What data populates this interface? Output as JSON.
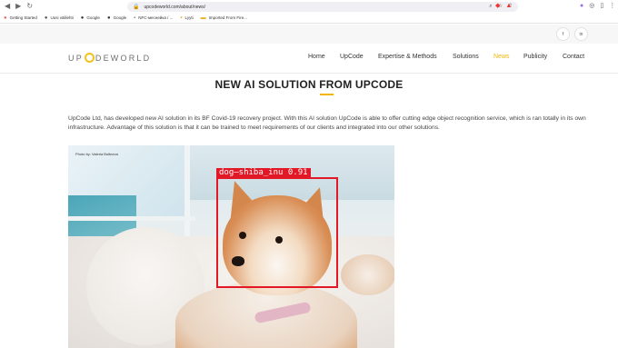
{
  "browser": {
    "url": "upcodeworld.com/about/news/",
    "bookmarks": [
      {
        "icon": "firefox-icon",
        "label": "Getting Started"
      },
      {
        "icon": "globe-icon",
        "label": "Uusi välilehti"
      },
      {
        "icon": "google-icon",
        "label": "Google"
      },
      {
        "icon": "google-icon",
        "label": "Google"
      },
      {
        "icon": "page-icon",
        "label": "NFC-меснейка / ..."
      },
      {
        "icon": "page-icon",
        "label": "Lyyti"
      },
      {
        "icon": "folder-icon",
        "label": "Imported From Fire..."
      }
    ]
  },
  "social": {
    "facebook": "f",
    "linkedin": "in"
  },
  "site": {
    "logo_left": "UP",
    "logo_right": "DEWORLD",
    "menu": [
      "Home",
      "UpCode",
      "Expertise & Methods",
      "Solutions",
      "News",
      "Publicity",
      "Contact"
    ],
    "active_menu": "News",
    "accent_color": "#f2b705"
  },
  "article": {
    "title": "NEW AI SOLUTION FROM UPCODE",
    "body": "UpCode Ltd, has developed new AI solution in its BF Covid-19 recovery project. With this AI solution UpCode is able to offer cutting edge object recognition service, which is ran totally in its own infrastructure. Advantage of this solution is that it can be trained to meet requirements of our clients and integrated into our other solutions.",
    "photo_credit": "Photo by: Valeria Boltneva",
    "detection_label": "dog–shiba_inu 0.91",
    "detection_color": "#e31826"
  }
}
